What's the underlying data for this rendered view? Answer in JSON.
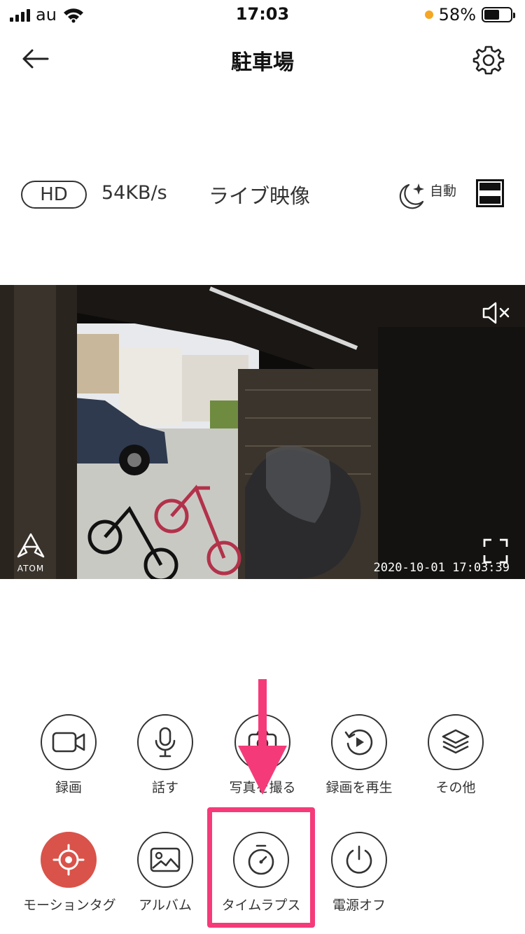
{
  "status_bar": {
    "carrier": "au",
    "time": "17:03",
    "battery_percent": "58%",
    "battery_level": 0.58,
    "icons": [
      "signal-icon",
      "wifi-icon",
      "orange-dot-icon",
      "battery-icon"
    ]
  },
  "nav": {
    "title": "駐車場",
    "back_icon": "back-arrow-icon",
    "settings_icon": "gear-icon"
  },
  "stream": {
    "quality": "HD",
    "speed": "54KB/s",
    "mode_label": "ライブ映像",
    "night_mode_label": "自動"
  },
  "video": {
    "timestamp": "2020-10-01  17:03:39",
    "logo_text": "ATOM",
    "mute_icon": "speaker-muted-icon",
    "fullscreen_icon": "fullscreen-icon"
  },
  "controls": {
    "row1": [
      {
        "label": "録画",
        "icon": "video-camera-icon"
      },
      {
        "label": "話す",
        "icon": "microphone-icon"
      },
      {
        "label": "写真を撮る",
        "icon": "camera-icon"
      },
      {
        "label": "録画を再生",
        "icon": "playback-icon"
      },
      {
        "label": "その他",
        "icon": "layers-icon"
      }
    ],
    "row2": [
      {
        "label": "モーションタグ",
        "icon": "target-icon",
        "active": true
      },
      {
        "label": "アルバム",
        "icon": "image-icon"
      },
      {
        "label": "タイムラプス",
        "icon": "stopwatch-icon"
      },
      {
        "label": "電源オフ",
        "icon": "power-icon"
      }
    ]
  },
  "colors": {
    "accent_red": "#d9534a",
    "highlight_pink": "#f53a7a",
    "battery_dot": "#f5a623"
  }
}
